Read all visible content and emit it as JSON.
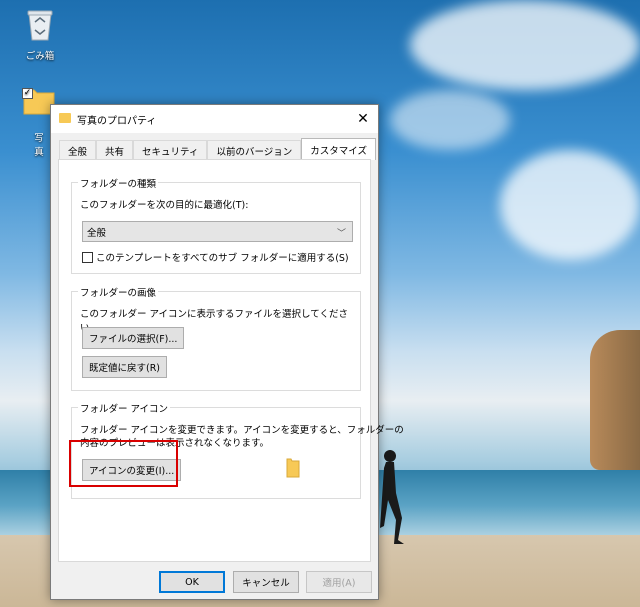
{
  "desktop": {
    "icons": [
      {
        "label": "ごみ箱",
        "icon": "recycle-bin-icon"
      },
      {
        "label": "写真",
        "icon": "folder-icon"
      }
    ]
  },
  "dialog": {
    "title": "写真のプロパティ",
    "tabs": [
      "全般",
      "共有",
      "セキュリティ",
      "以前のバージョン",
      "カスタマイズ"
    ],
    "active_tab": "カスタマイズ",
    "folder_type": {
      "heading": "フォルダーの種類",
      "optimize_label": "このフォルダーを次の目的に最適化(T):",
      "selected_value": "全般",
      "apply_subfolders_label": "このテンプレートをすべてのサブ フォルダーに適用する(S)",
      "apply_subfolders_checked": false
    },
    "folder_picture": {
      "heading": "フォルダーの画像",
      "description": "このフォルダー アイコンに表示するファイルを選択してください。",
      "choose_file_button": "ファイルの選択(F)...",
      "restore_default_button": "既定値に戻す(R)"
    },
    "folder_icon": {
      "heading": "フォルダー アイコン",
      "description_line1": "フォルダー アイコンを変更できます。アイコンを変更すると、フォルダーの",
      "description_line2": "内容のプレビューは表示されなくなります。",
      "change_icon_button": "アイコンの変更(I)..."
    },
    "footer": {
      "ok": "OK",
      "cancel": "キャンセル",
      "apply": "適用(A)"
    }
  },
  "colors": {
    "accent": "#0078d7",
    "highlight_box": "#d90000",
    "folder_yellow": "#f7c956"
  }
}
